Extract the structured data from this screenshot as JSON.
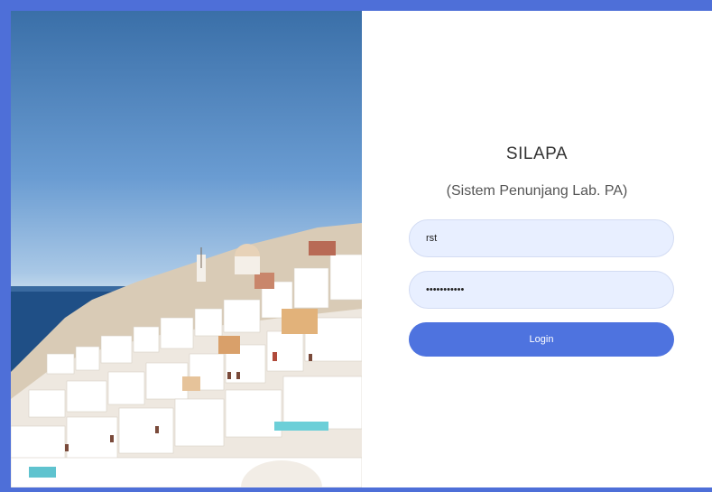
{
  "app": {
    "title": "SILAPA",
    "subtitle": "(Sistem Penunjang Lab. PA)"
  },
  "form": {
    "username_value": "rst",
    "password_value": "•••••••••••",
    "login_label": "Login"
  },
  "colors": {
    "accent": "#4e73df",
    "input_bg": "#e8efff",
    "frame_border": "#4e6fd8"
  }
}
